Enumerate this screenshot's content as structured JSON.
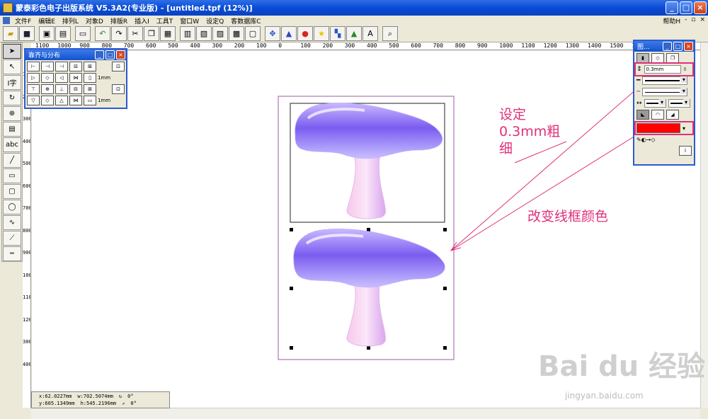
{
  "window": {
    "title": "蒙泰彩色电子出版系统 V5.3A2(专业版) - [untitled.tpf (12%)]",
    "buttons": [
      "_",
      "□",
      "×"
    ]
  },
  "menu": {
    "items": [
      "文件F",
      "编辑E",
      "排列L",
      "对象D",
      "排版R",
      "插入I",
      "工具T",
      "窗口W",
      "设定Q",
      "客数据库C"
    ],
    "help": "帮助H",
    "right_controls": [
      "-",
      "▫",
      "×"
    ]
  },
  "ruler_top_labels": [
    "1100",
    "1000",
    "900",
    "800",
    "700",
    "600",
    "500",
    "400",
    "300",
    "200",
    "100",
    "0",
    "100",
    "200",
    "300",
    "400",
    "500",
    "600",
    "700",
    "800",
    "900",
    "1000",
    "1100",
    "1200",
    "1300",
    "1400",
    "1500",
    "160"
  ],
  "ruler_left_labels": [
    "100",
    "200",
    "300",
    "400",
    "500",
    "600",
    "700",
    "800",
    "900",
    "1000",
    "1100",
    "1200",
    "300",
    "400"
  ],
  "align_panel": {
    "title": "靠齐与分布",
    "unit_label_1": "1mm",
    "unit_label_2": "1mm"
  },
  "line_panel": {
    "title": "图...",
    "thickness_value": "0.3mm",
    "line_color": "#ff0000"
  },
  "status": {
    "x": "x:62.0227mm",
    "y": "y:605.1349mm",
    "w": "w:702.5074mm",
    "h": "h:545.2196mm",
    "rot": "0°",
    "skew": "0°"
  },
  "annotations": {
    "thickness_note": [
      "设定",
      "0.3mm粗",
      "细"
    ],
    "color_note": "改变线框颜色",
    "accent_color": "#e0307a"
  },
  "watermark": {
    "main": "Bai du 经验",
    "sub": "jingyan.baidu.com"
  },
  "icons": {
    "tools": [
      "arrow-icon",
      "node-arrow-icon",
      "text-icon",
      "rotate-icon",
      "zoom-icon",
      "page-icon",
      "abc-icon",
      "line-icon",
      "rect-icon",
      "round-rect-icon",
      "ellipse-icon",
      "curve-icon",
      "pen-icon",
      "ruler-tool-icon"
    ]
  }
}
